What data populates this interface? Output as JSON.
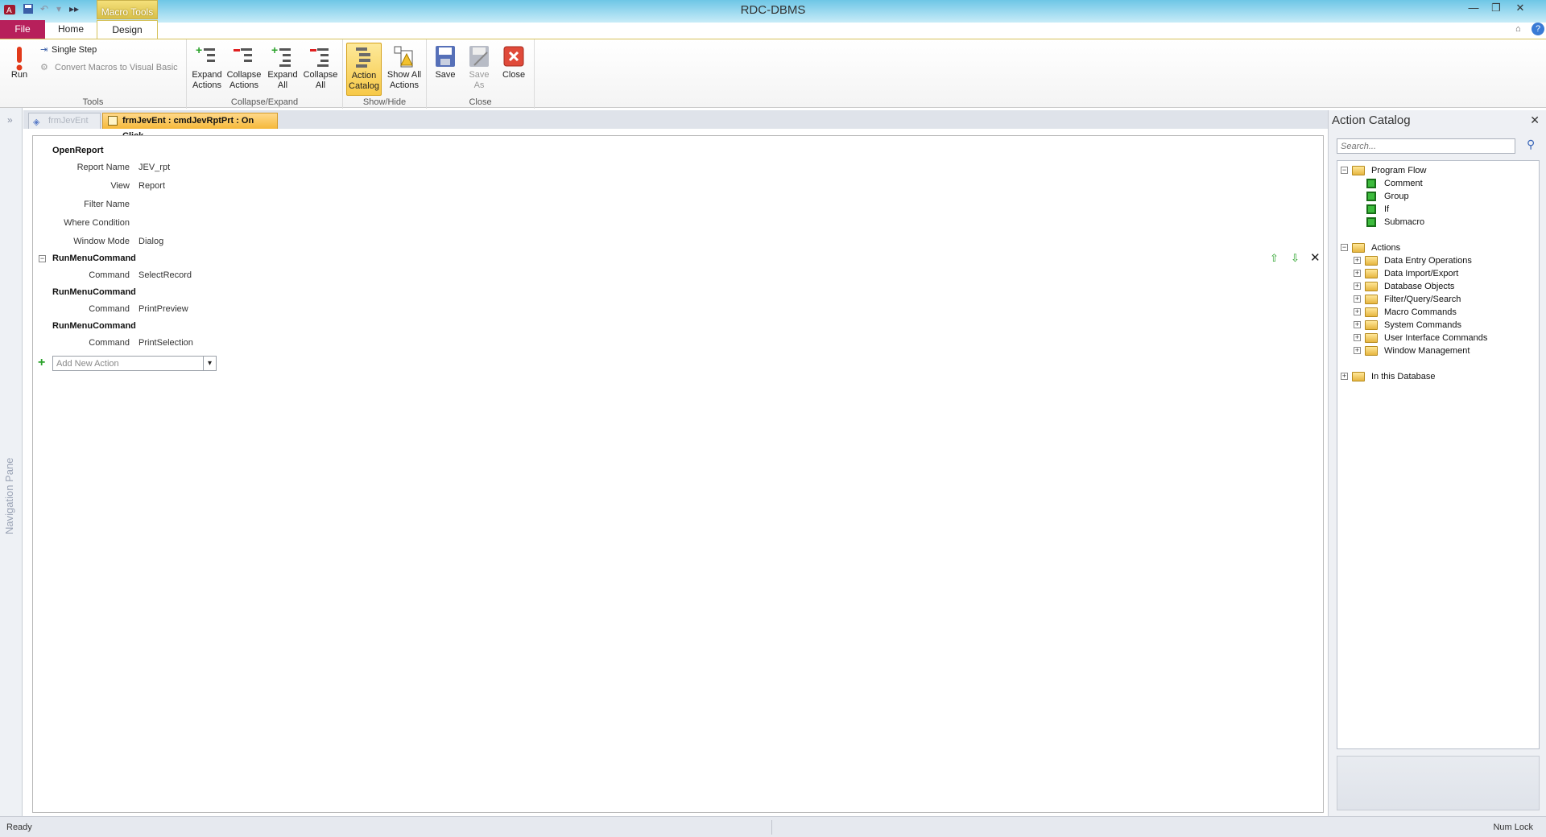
{
  "window": {
    "title": "RDC-DBMS"
  },
  "ribbon": {
    "contextual_label": "Macro Tools",
    "tabs": [
      {
        "label": "File"
      },
      {
        "label": "Home"
      },
      {
        "label": "Design"
      }
    ],
    "groups": {
      "tools": {
        "label": "Tools",
        "run": "Run",
        "single_step": "Single Step",
        "convert": "Convert Macros to Visual Basic"
      },
      "collapse_expand": {
        "label": "Collapse/Expand",
        "expand_actions": [
          "Expand",
          "Actions"
        ],
        "collapse_actions": [
          "Collapse",
          "Actions"
        ],
        "expand_all": [
          "Expand",
          "All"
        ],
        "collapse_all": [
          "Collapse",
          "All"
        ]
      },
      "show_hide": {
        "label": "Show/Hide",
        "action_catalog": [
          "Action",
          "Catalog"
        ],
        "show_all_actions": [
          "Show All",
          "Actions"
        ]
      },
      "close": {
        "label": "Close",
        "save": "Save",
        "save_as": [
          "Save",
          "As"
        ],
        "close": "Close"
      }
    }
  },
  "nav_pane": {
    "label": "Navigation Pane"
  },
  "doc_tabs": [
    {
      "label": "frmJevEnt"
    },
    {
      "label": "frmJevEnt : cmdJevRptPrt : On Click"
    }
  ],
  "macro": {
    "actions": [
      {
        "name": "OpenReport",
        "args": [
          {
            "label": "Report Name",
            "value": "JEV_rpt"
          },
          {
            "label": "View",
            "value": "Report"
          },
          {
            "label": "Filter Name",
            "value": ""
          },
          {
            "label": "Where Condition",
            "value": ""
          },
          {
            "label": "Window Mode",
            "value": "Dialog"
          }
        ]
      },
      {
        "name": "RunMenuCommand",
        "args": [
          {
            "label": "Command",
            "value": "SelectRecord"
          }
        ]
      },
      {
        "name": "RunMenuCommand",
        "args": [
          {
            "label": "Command",
            "value": "PrintPreview"
          }
        ]
      },
      {
        "name": "RunMenuCommand",
        "args": [
          {
            "label": "Command",
            "value": "PrintSelection"
          }
        ]
      }
    ],
    "add_new_placeholder": "Add New Action"
  },
  "catalog": {
    "title": "Action Catalog",
    "search_placeholder": "Search...",
    "program_flow": {
      "label": "Program Flow",
      "items": [
        "Comment",
        "Group",
        "If",
        "Submacro"
      ]
    },
    "actions": {
      "label": "Actions",
      "items": [
        "Data Entry Operations",
        "Data Import/Export",
        "Database Objects",
        "Filter/Query/Search",
        "Macro Commands",
        "System Commands",
        "User Interface Commands",
        "Window Management"
      ]
    },
    "in_db": {
      "label": "In this Database"
    }
  },
  "status": {
    "left": "Ready",
    "right": "Num Lock"
  }
}
